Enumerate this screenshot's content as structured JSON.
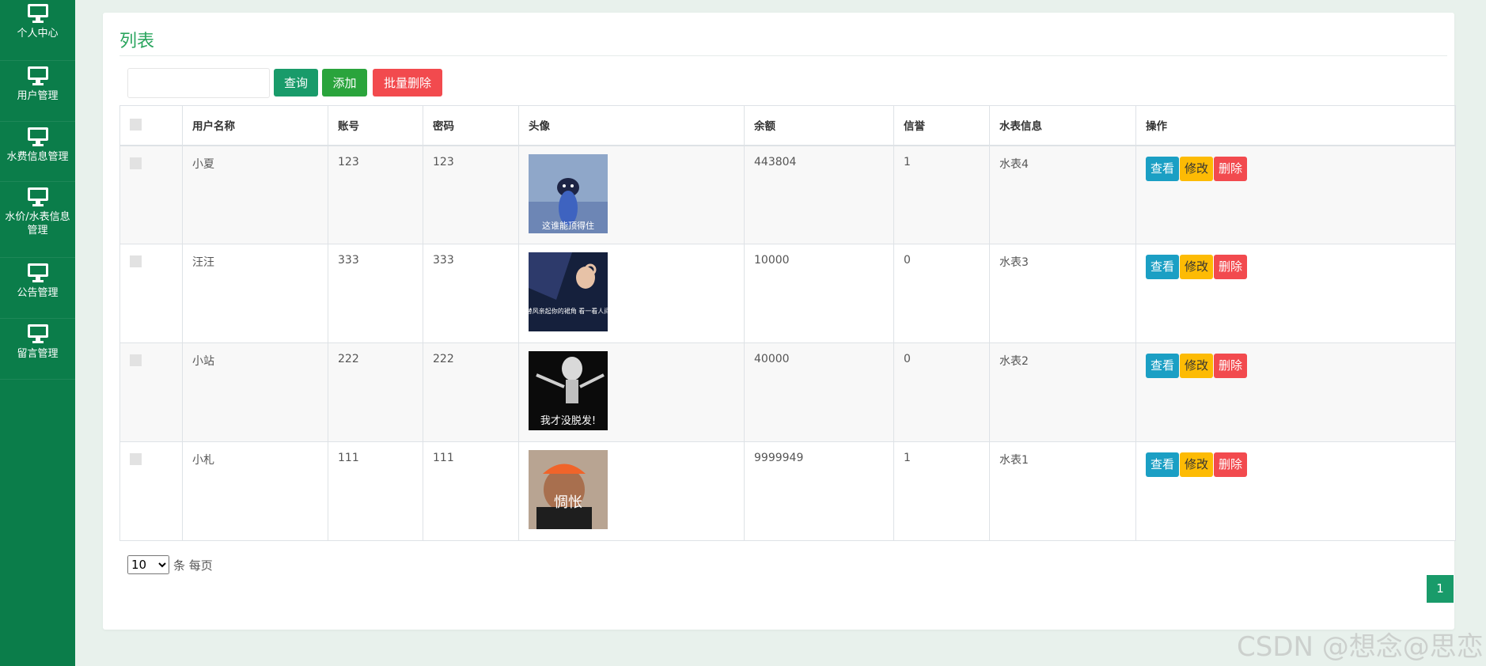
{
  "sidebar": {
    "items": [
      {
        "label": "个人中心",
        "icon": "monitor-icon"
      },
      {
        "label": "用户管理",
        "icon": "monitor-icon"
      },
      {
        "label": "水费信息管理",
        "icon": "monitor-icon"
      },
      {
        "label": "水价/水表信息管理",
        "icon": "monitor-icon"
      },
      {
        "label": "公告管理",
        "icon": "monitor-icon"
      },
      {
        "label": "留言管理",
        "icon": "monitor-icon"
      }
    ]
  },
  "page": {
    "title": "列表"
  },
  "toolbar": {
    "search_value": "",
    "query_label": "查询",
    "add_label": "添加",
    "batch_delete_label": "批量删除"
  },
  "table": {
    "headers": [
      "",
      "用户名称",
      "账号",
      "密码",
      "头像",
      "余额",
      "信誉",
      "水表信息",
      "操作"
    ],
    "rows": [
      {
        "name": "小夏",
        "account": "123",
        "password": "123",
        "avatar_caption": "这谁能顶得住",
        "balance": "443804",
        "credit": "1",
        "meter": "水表4"
      },
      {
        "name": "汪汪",
        "account": "333",
        "password": "333",
        "avatar_caption": "好想替风亲起你的裙角 看一看人间仙境",
        "balance": "10000",
        "credit": "0",
        "meter": "水表3"
      },
      {
        "name": "小站",
        "account": "222",
        "password": "222",
        "avatar_caption": "我才没脱发!",
        "balance": "40000",
        "credit": "0",
        "meter": "水表2"
      },
      {
        "name": "小札",
        "account": "111",
        "password": "111",
        "avatar_caption": "惆怅",
        "balance": "9999949",
        "credit": "1",
        "meter": "水表1"
      }
    ],
    "actions": {
      "view_label": "查看",
      "edit_label": "修改",
      "delete_label": "删除"
    }
  },
  "pagination": {
    "page_size": "10",
    "page_size_suffix": "条 每页",
    "current_page": "1"
  },
  "watermark": "CSDN @想念@思恋",
  "colors": {
    "sidebar_bg": "#0b7d4a",
    "title": "#2aa55e",
    "query": "#199b6a",
    "add": "#2aa43c",
    "danger": "#f24a4e",
    "view": "#1b9fc4",
    "edit": "#fdbb04"
  }
}
